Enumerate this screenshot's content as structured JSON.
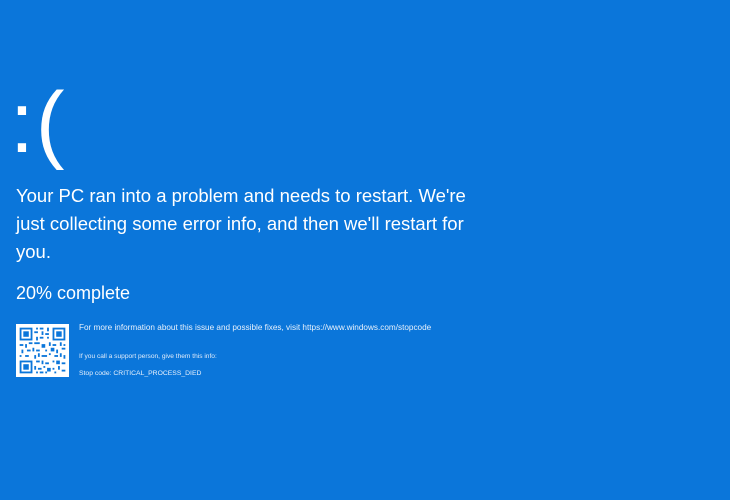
{
  "screen": {
    "background_color": "#0b76da",
    "sad_face": ":(",
    "headline": "Your PC ran into a problem and needs to restart. We're just collecting some error info, and then we'll restart for you.",
    "progress_text": "20% complete",
    "progress_percent": 20,
    "more_info": "For more information about this issue and possible fixes, visit https://www.windows.com/stopcode",
    "support_text": "If you call a support person, give them this info:",
    "stop_code": "Stop code: CRITICAL_PROCESS_DIED",
    "qr_icon": "qr-code-icon"
  }
}
